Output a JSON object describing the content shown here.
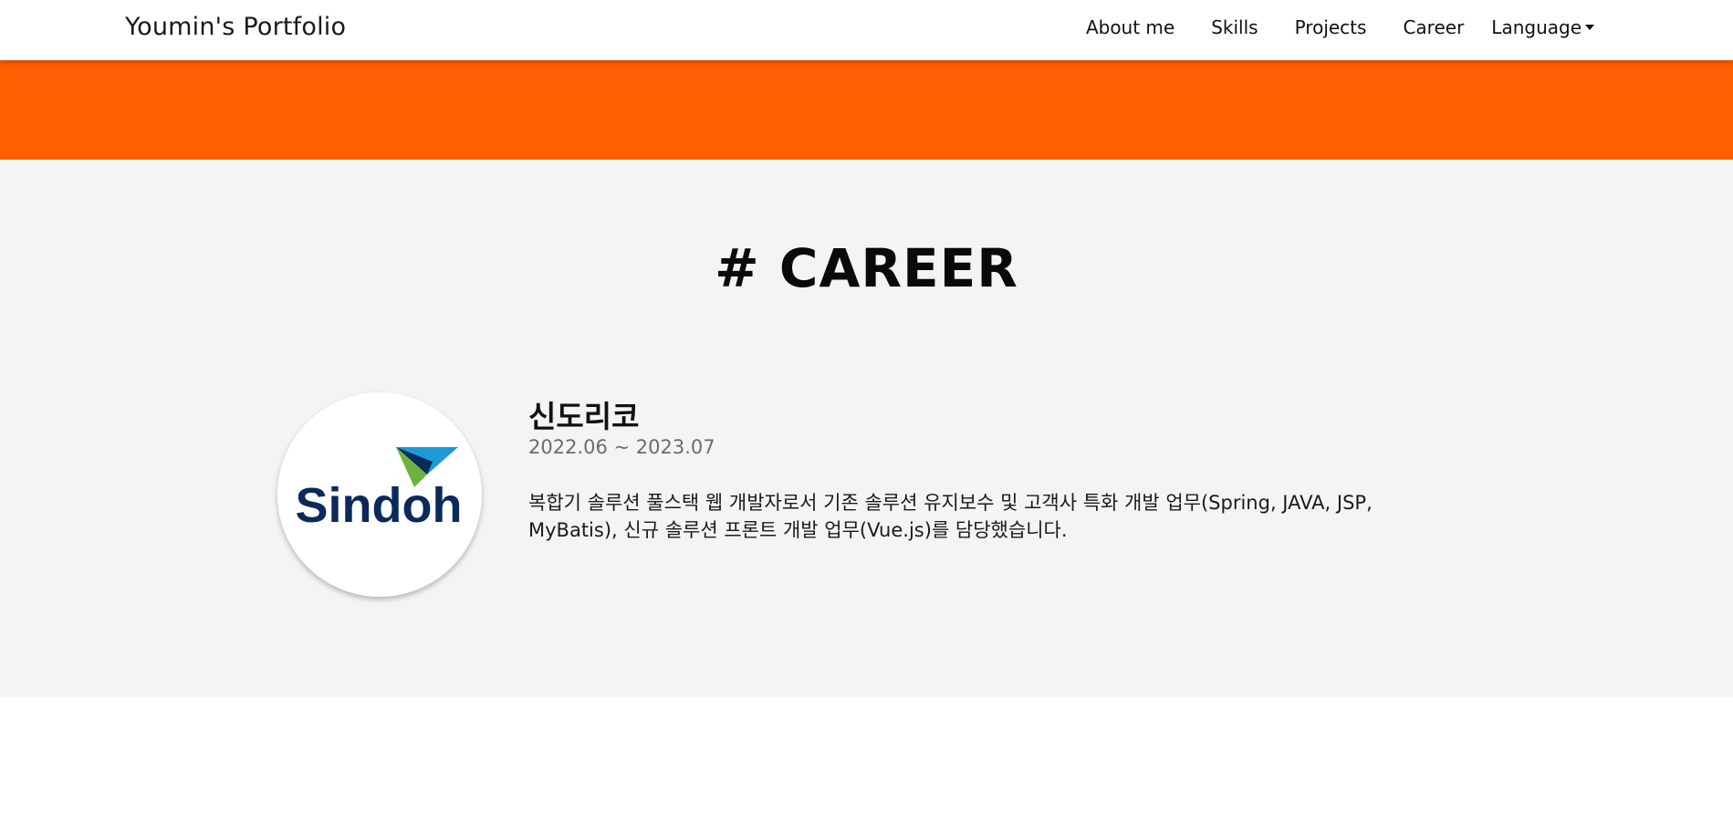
{
  "navbar": {
    "brand": "Youmin's Portfolio",
    "links": [
      {
        "label": "About me"
      },
      {
        "label": "Skills"
      },
      {
        "label": "Projects"
      },
      {
        "label": "Career"
      }
    ],
    "language_label": "Language"
  },
  "colors": {
    "accent": "#ff5e03",
    "section_bg": "#f4f4f4",
    "logo_navy": "#0b2a5b",
    "logo_green": "#6cb33e",
    "logo_blue": "#1d9ad6"
  },
  "career": {
    "title": "# CAREER",
    "items": [
      {
        "company": "신도리코",
        "period": "2022.06 ~ 2023.07",
        "description": "복합기 솔루션 풀스택 웹 개발자로서 기존 솔루션 유지보수 및 고객사 특화 개발 업무(Spring, JAVA, JSP, MyBatis), 신규 솔루션 프론트 개발 업무(Vue.js)를 담당했습니다.",
        "logo_text": "Sindoh"
      }
    ]
  }
}
